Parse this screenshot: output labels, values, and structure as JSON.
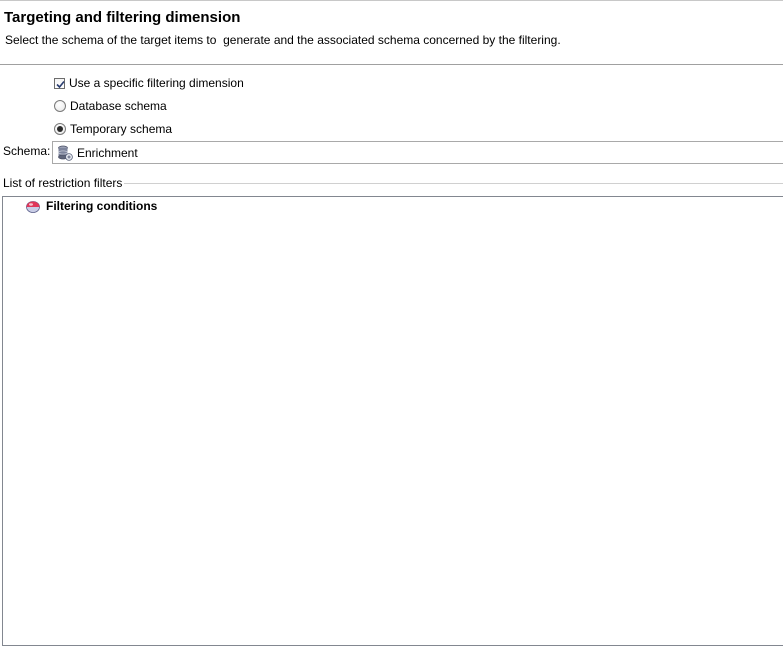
{
  "header": {
    "title": "Targeting and filtering dimension",
    "subtitle": "Select the schema of the target items to  generate and the associated schema concerned by the filtering."
  },
  "options": {
    "use_specific": {
      "label": "Use a specific filtering dimension",
      "checked": true
    },
    "database_schema": {
      "label": "Database schema",
      "selected": false
    },
    "temporary_schema": {
      "label": "Temporary schema",
      "selected": true
    }
  },
  "schema": {
    "label": "Schema:",
    "value": "Enrichment",
    "icon": "database-schema-icon"
  },
  "filters": {
    "group_label": "List of restriction filters",
    "tree": [
      {
        "label": "Filtering conditions",
        "icon": "filter-conditions-icon"
      }
    ]
  },
  "colors": {
    "header_border": "#a0a0a0",
    "tree_border": "#828790",
    "filter_icon": "#e0365a"
  }
}
